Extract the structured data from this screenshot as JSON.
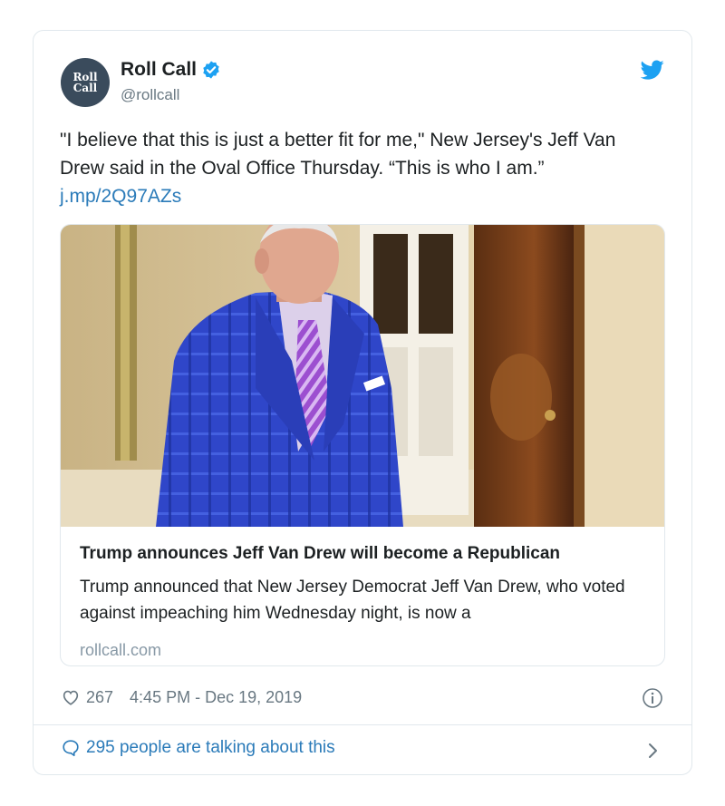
{
  "author": {
    "avatar_line1": "Roll",
    "avatar_line2": "Call",
    "display_name": "Roll Call",
    "handle": "@rollcall"
  },
  "tweet": {
    "text": "\"I believe that this is just a better fit for me,\" New Jersey's Jeff Van Drew said in the Oval Office Thursday. “This is who I am.”",
    "link": "j.mp/2Q97AZs"
  },
  "card": {
    "title": "Trump announces Jeff Van Drew will become a Republican",
    "description": "Trump announced that New Jersey Democrat Jeff Van Drew, who voted against impeaching him Wednesday night, is now a",
    "domain": "rollcall.com"
  },
  "footer": {
    "likes": "267",
    "timestamp": "4:45 PM - Dec 19, 2019",
    "talking": "295 people are talking about this"
  },
  "colors": {
    "link": "#2b7bb9",
    "verified": "#1da1f2",
    "muted": "#697882"
  },
  "icons": [
    "verified-badge-icon",
    "twitter-bird-icon",
    "heart-icon",
    "info-icon",
    "speech-bubble-icon",
    "chevron-right-icon"
  ]
}
